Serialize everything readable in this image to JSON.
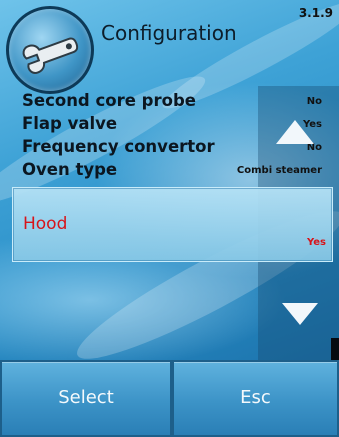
{
  "header": {
    "title": "Configuration",
    "version": "3.1.9"
  },
  "config_items": [
    {
      "label": "Second core probe",
      "value": "No"
    },
    {
      "label": "Flap valve",
      "value": "Yes"
    },
    {
      "label": "Frequency convertor",
      "value": "No"
    },
    {
      "label": "Oven type",
      "value": "Combi steamer"
    }
  ],
  "selected_item": {
    "label": "Hood",
    "value": "Yes"
  },
  "buttons": {
    "select_label": "Select",
    "esc_label": "Esc"
  },
  "icons": {
    "logo": "wrench-icon",
    "scroll_up": "arrow-up-icon",
    "scroll_down": "arrow-down-icon"
  },
  "colors": {
    "selected_text": "#d7141a",
    "background": "#2b8fc8"
  }
}
